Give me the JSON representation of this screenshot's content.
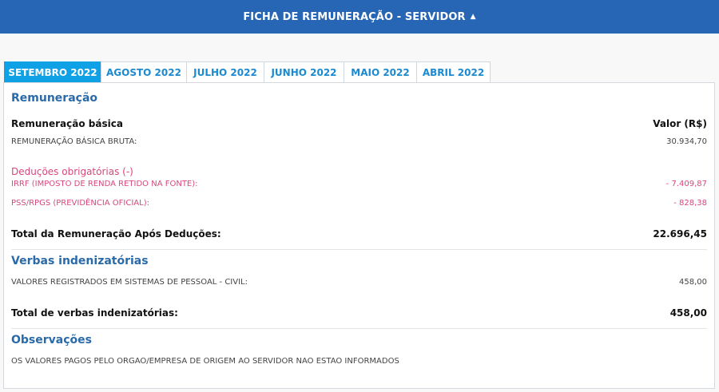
{
  "header": {
    "title": "FICHA DE REMUNERAÇÃO - SERVIDOR",
    "caret_icon": "caret-up-icon"
  },
  "tabs": [
    {
      "label": "SETEMBRO 2022",
      "active": true
    },
    {
      "label": "AGOSTO 2022",
      "active": false
    },
    {
      "label": "JULHO 2022",
      "active": false
    },
    {
      "label": "JUNHO 2022",
      "active": false
    },
    {
      "label": "MAIO 2022",
      "active": false
    },
    {
      "label": "ABRIL 2022",
      "active": false
    }
  ],
  "remuneracao": {
    "title": "Remuneração",
    "basic_header": "Remuneração básica",
    "value_header": "Valor (R$)",
    "bruta_label": "REMUNERAÇÃO BÁSICA BRUTA:",
    "bruta_value": "30.934,70"
  },
  "deducoes": {
    "title": "Deduções obrigatórias (-)",
    "irrf_label": "IRRF (IMPOSTO DE RENDA RETIDO NA FONTE):",
    "irrf_value": "- 7.409,87",
    "pss_label": "PSS/RPGS (PREVIDÊNCIA OFICIAL):",
    "pss_value": "- 828,38"
  },
  "total_apos": {
    "label": "Total da Remuneração Após Deduções:",
    "value": "22.696,45"
  },
  "verbas": {
    "title": "Verbas indenizatórias",
    "item_label": "VALORES REGISTRADOS EM SISTEMAS DE PESSOAL - CIVIL:",
    "item_value": "458,00",
    "total_label": "Total de verbas indenizatórias:",
    "total_value": "458,00"
  },
  "observacoes": {
    "title": "Observações",
    "text": "OS VALORES PAGOS PELO ORGAO/EMPRESA DE ORIGEM AO SERVIDOR NAO ESTAO INFORMADOS"
  }
}
